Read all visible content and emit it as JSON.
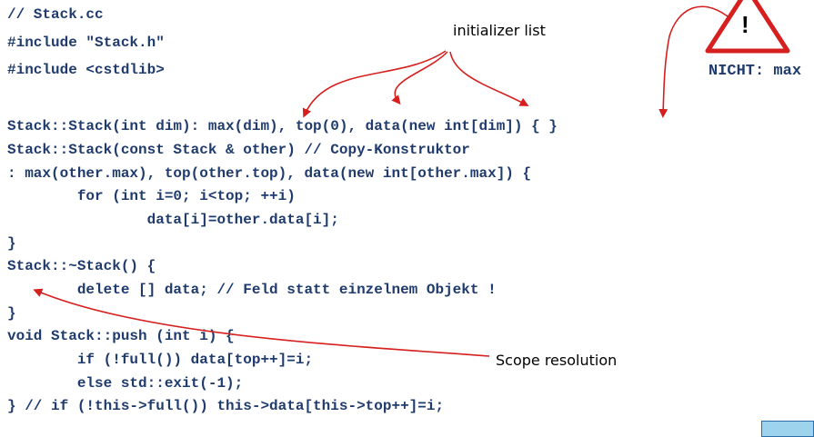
{
  "code_lines": [
    "// Stack.cc",
    "#include \"Stack.h\"",
    "#include <cstdlib>",
    "",
    "Stack::Stack(int dim): max(dim), top(0), data(new int[dim]) { }",
    "Stack::Stack(const Stack & other) // Copy-Konstruktor",
    ": max(other.max), top(other.top), data(new int[other.max]) {",
    "        for (int i=0; i<top; ++i)",
    "                data[i]=other.data[i];",
    "}",
    "Stack::~Stack() {",
    "        delete [] data; // Feld statt einzelnem Objekt !",
    "}",
    "void Stack::push (int i) {",
    "        if (!full()) data[top++]=i;",
    "        else std::exit(-1);",
    "} // if (!this->full()) this->data[this->top++]=i;"
  ],
  "annotations": {
    "initializer_list": "initializer list",
    "scope_resolution": "Scope resolution",
    "warning_text": "NICHT: max",
    "warning_symbol": "!"
  },
  "icons": {
    "warning": "warning-triangle-icon"
  },
  "colors": {
    "code": "#1f3b6e",
    "arrow": "#d62020",
    "warning_fill": "#ffffff",
    "warning_border": "#d62020"
  }
}
